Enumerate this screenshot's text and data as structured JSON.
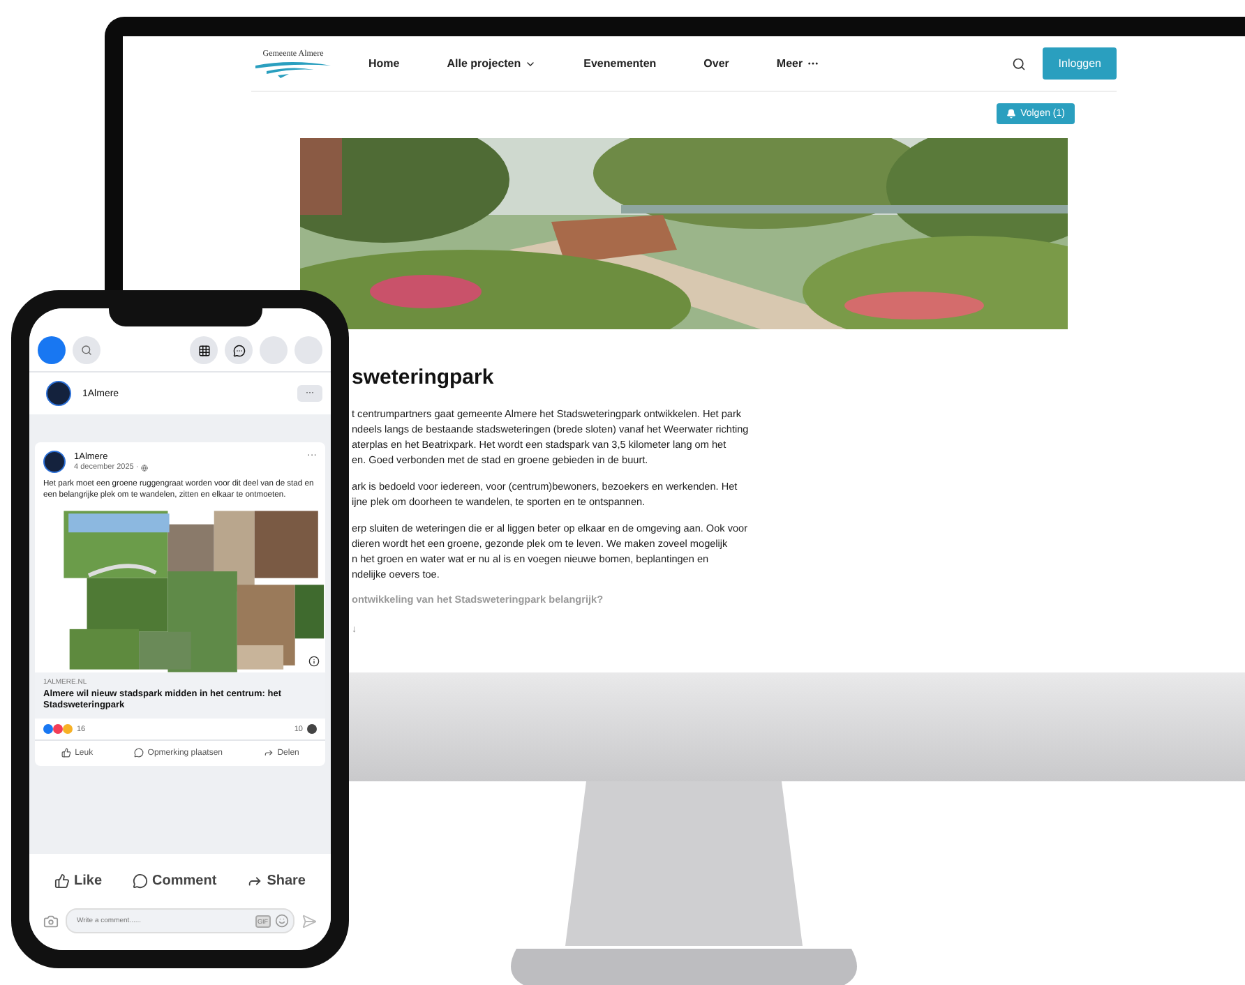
{
  "website": {
    "logo_text": "Gemeente Almere",
    "nav": [
      {
        "label": "Home",
        "kind": "plain"
      },
      {
        "label": "Alle projecten",
        "kind": "dropdown"
      },
      {
        "label": "Evenementen",
        "kind": "plain"
      },
      {
        "label": "Over",
        "kind": "plain"
      },
      {
        "label": "Meer",
        "kind": "more"
      }
    ],
    "login_button": "Inloggen",
    "follow_button": "Volgen (1)",
    "hero": {
      "kind": "picture"
    },
    "heading": "sweteringpark",
    "paragraphs": [
      [
        "t centrumpartners gaat gemeente Almere het Stadsweteringpark ontwikkelen. Het park",
        "ndeels langs de bestaande stadsweteringen (brede sloten) vanaf het Weerwater richting",
        "aterplas en het Beatrixpark. Het wordt een stadspark van 3,5 kilometer lang om het",
        "en. Goed verbonden met de stad en groene gebieden in de buurt."
      ],
      [
        "ark is bedoeld voor iedereen, voor (centrum)bewoners, bezoekers en werkenden. Het",
        "ijne plek om doorheen te wandelen, te sporten en te ontspannen."
      ],
      [
        "erp sluiten de weteringen die er al liggen beter op elkaar en de omgeving aan. Ook voor",
        "dieren wordt het een groene, gezonde plek om te leven. We maken zoveel mogelijk",
        "n het groen en water wat er nu al is en voegen nieuwe bomen, beplantingen en",
        "ndelijke oevers toe."
      ]
    ],
    "subheading": "ontwikkeling van het Stadsweteringpark belangrijk?",
    "more_arrow": "↓"
  },
  "phone": {
    "page_name": "1Almere",
    "more_button": "···",
    "post": {
      "author": "1Almere",
      "date": "4 december 2025 ·",
      "more": "···",
      "text": "Het park moet een groene ruggengraat worden voor dit deel van de stad en een belangrijke plek om te wandelen, zitten en elkaar te ontmoeten.",
      "image": {
        "kind": "picture"
      },
      "link_domain": "1ALMERE.NL",
      "link_title": "Almere wil nieuw stadspark midden in het centrum: het Stadsweteringpark",
      "reactions_count": "16",
      "comments_count": "10",
      "actions": [
        "Leuk",
        "Opmerking plaatsen",
        "Delen"
      ]
    },
    "bottom_actions": [
      "Like",
      "Comment",
      "Share"
    ],
    "comment_placeholder": "Write a comment......",
    "gif_label": "GIF"
  }
}
